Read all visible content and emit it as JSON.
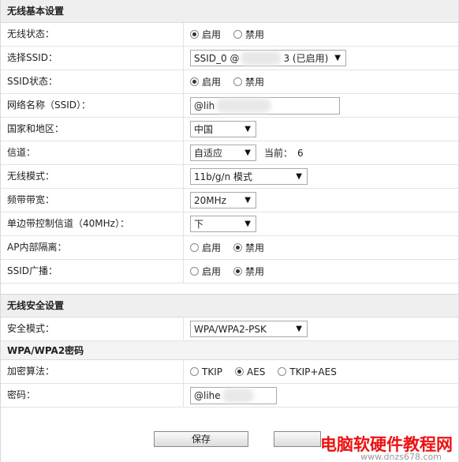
{
  "wireless_basic": {
    "title": "无线基本设置",
    "rows": {
      "wireless_status": {
        "label": "无线状态：",
        "opt_enable": "启用",
        "opt_disable": "禁用"
      },
      "select_ssid": {
        "label": "选择SSID：",
        "value": "SSID_0 @",
        "value_suffix": "3 (已启用)"
      },
      "ssid_status": {
        "label": "SSID状态：",
        "opt_enable": "启用",
        "opt_disable": "禁用"
      },
      "network_name": {
        "label": "网络名称（SSID）：",
        "value": "@lih"
      },
      "country": {
        "label": "国家和地区：",
        "value": "中国"
      },
      "channel": {
        "label": "信道：",
        "value": "自适应",
        "current_label": "当前：",
        "current_value": "6"
      },
      "wireless_mode": {
        "label": "无线模式：",
        "value": "11b/g/n 模式"
      },
      "bandwidth": {
        "label": "频带带宽：",
        "value": "20MHz"
      },
      "sideband": {
        "label": "单边带控制信道（40MHz）：",
        "value": "下"
      },
      "ap_isolation": {
        "label": "AP内部隔离：",
        "opt_enable": "启用",
        "opt_disable": "禁用"
      },
      "ssid_broadcast": {
        "label": "SSID广播：",
        "opt_enable": "启用",
        "opt_disable": "禁用"
      }
    }
  },
  "wireless_security": {
    "title": "无线安全设置",
    "security_mode": {
      "label": "安全模式：",
      "value": "WPA/WPA2-PSK"
    },
    "wpa_title": "WPA/WPA2密码",
    "encryption": {
      "label": "加密算法：",
      "opt_tkip": "TKIP",
      "opt_aes": "AES",
      "opt_tkip_aes": "TKIP+AES"
    },
    "password": {
      "label": "密码：",
      "value": "@lihe"
    }
  },
  "buttons": {
    "save": "保存"
  },
  "watermark": {
    "main": "电脑软硬件教程网",
    "sub": "www.dnzs678.com"
  }
}
